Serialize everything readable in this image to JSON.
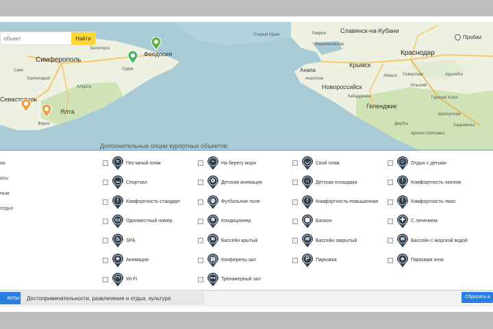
{
  "search": {
    "placeholder": "объект",
    "button_label": "Найти"
  },
  "map": {
    "traffic_label": "Пробки",
    "labels_big": [
      "Симферополь",
      "Краснодар",
      "Славянск-на-Кубани"
    ],
    "labels_mid": [
      "Феодосия",
      "Севастополь",
      "Ялта",
      "Крымск",
      "Анапа",
      "Новороссийск",
      "Геленджик"
    ],
    "labels_small": [
      "Белогорск",
      "Старый Крым",
      "Судак",
      "Алушта",
      "Бахчисарай",
      "Форос",
      "Темрюк",
      "Варениковская",
      "Абинск",
      "Горячий Ключ",
      "Северская",
      "Адыгейск",
      "Ильский",
      "Кабардинка",
      "Джубга",
      "Архипо-Осиповка",
      "Шапсугская",
      "Хадыженск",
      "Саки",
      "Анапская"
    ]
  },
  "sidebar": {
    "items": [
      "ии",
      "аты",
      "ным",
      "отдых"
    ]
  },
  "options": {
    "title": "Дополнительные опции курортных объектов:",
    "items": [
      {
        "label": "Песчаный пляж",
        "icon": "beach-icon"
      },
      {
        "label": "На берегу моря",
        "icon": "sea-icon"
      },
      {
        "label": "Свой пляж",
        "icon": "own-beach-icon"
      },
      {
        "label": "Отдых с детьми",
        "icon": "family-icon"
      },
      {
        "label": "Спортзал",
        "icon": "gym-icon"
      },
      {
        "label": "Детская анимация",
        "icon": "kids-animation-icon"
      },
      {
        "label": "Детская площадка",
        "icon": "playground-icon"
      },
      {
        "label": "Комфортность-эконом",
        "icon": "comfort-economy-icon"
      },
      {
        "label": "Комфортность-стандарт",
        "icon": "comfort-standard-icon"
      },
      {
        "label": "Футбольное поле",
        "icon": "football-icon"
      },
      {
        "label": "Комфортность-повышенная",
        "icon": "comfort-plus-icon"
      },
      {
        "label": "Комфортность-люкс",
        "icon": "comfort-lux-icon"
      },
      {
        "label": "Одноместный номер",
        "icon": "single-room-icon"
      },
      {
        "label": "Кондиционер",
        "icon": "aircon-icon"
      },
      {
        "label": "Балкон",
        "icon": "balcony-icon"
      },
      {
        "label": "С лечением",
        "icon": "treatment-icon"
      },
      {
        "label": "SPA",
        "icon": "spa-icon"
      },
      {
        "label": "Бассейн крытый",
        "icon": "indoor-pool-icon"
      },
      {
        "label": "Бассейн закрытый",
        "icon": "closed-pool-icon"
      },
      {
        "label": "Бассейн с морской водой",
        "icon": "seawater-pool-icon"
      },
      {
        "label": "Анимация",
        "icon": "animation-icon"
      },
      {
        "label": "Конференц-зал",
        "icon": "conference-icon"
      },
      {
        "label": "Парковка",
        "icon": "parking-icon"
      },
      {
        "label": "Парковая зона",
        "icon": "park-icon"
      },
      {
        "label": "Wi-Fi",
        "icon": "wifi-icon"
      },
      {
        "label": "Тренажерный зал",
        "icon": "fitness-icon"
      }
    ]
  },
  "bottom": {
    "tab_objects": "екты",
    "tab_sights": "Достопримечательности, развлечения и отдых, культура",
    "reset_button": "Сбросить в"
  },
  "colors": {
    "accent": "#2a7de1",
    "search_button": "#ffd633",
    "pin": "#2f3f4f",
    "sea": "#a9cbd6",
    "land": "#eef0e4"
  }
}
